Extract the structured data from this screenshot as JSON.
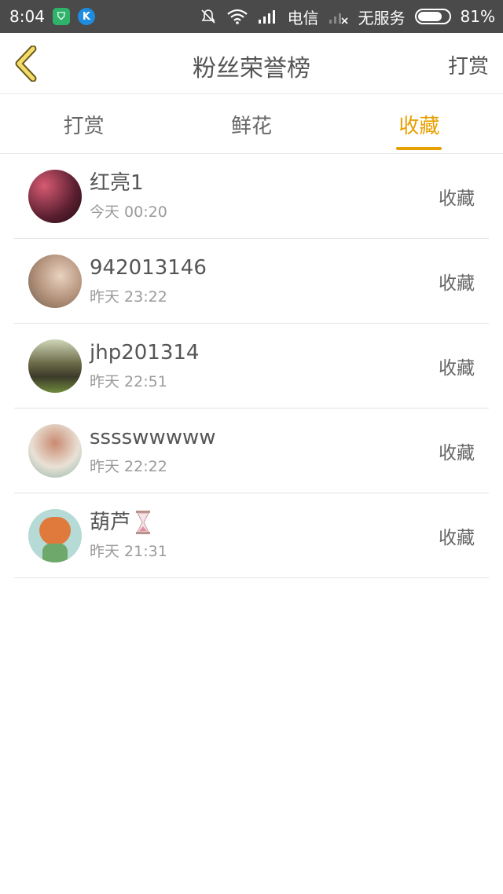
{
  "status_bar": {
    "time": "8:04",
    "carrier": "电信",
    "no_service": "无服务",
    "battery": "81%",
    "battery_level": 0.81
  },
  "header": {
    "title": "粉丝荣誉榜",
    "action": "打赏"
  },
  "tabs": [
    {
      "label": "打赏",
      "active": false
    },
    {
      "label": "鲜花",
      "active": false
    },
    {
      "label": "收藏",
      "active": true
    }
  ],
  "list": [
    {
      "name": "红亮1",
      "time": "今天 00:20",
      "action": "收藏"
    },
    {
      "name": "942013146",
      "time": "昨天 23:22",
      "action": "收藏"
    },
    {
      "name": "jhp201314",
      "time": "昨天 22:51",
      "action": "收藏"
    },
    {
      "name": "sssswwwww",
      "time": "昨天 22:22",
      "action": "收藏"
    },
    {
      "name": "葫芦",
      "time": "昨天 21:31",
      "action": "收藏"
    }
  ],
  "colors": {
    "accent": "#e7a000",
    "status_bar": "#4a4a4a",
    "back_arrow": "#f2dd6b"
  }
}
